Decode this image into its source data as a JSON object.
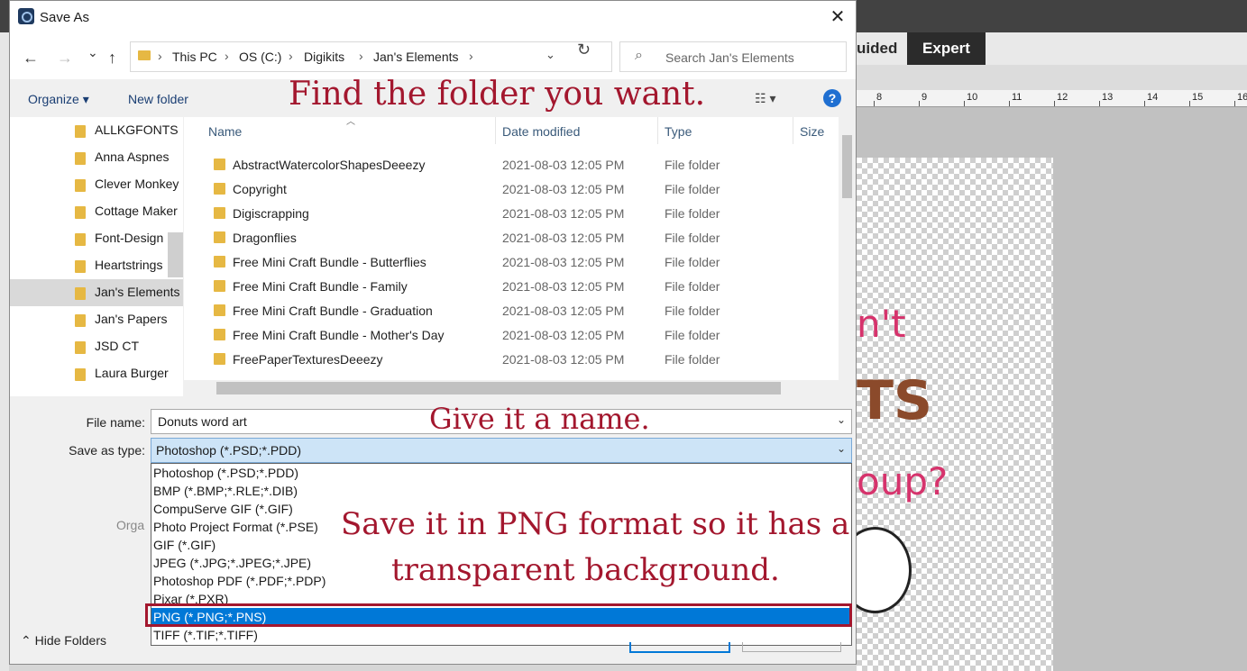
{
  "app": {
    "modes": {
      "guided": "uided",
      "expert": "Expert"
    },
    "ruler_numbers": [
      "8",
      "9",
      "10",
      "11",
      "12",
      "13",
      "14",
      "15",
      "16"
    ],
    "art_lines": [
      "n't",
      "TS",
      "oup?"
    ]
  },
  "dialog": {
    "title": "Save As",
    "close": "✕",
    "nav": {
      "back": "←",
      "forward": "→",
      "recent": "⌄",
      "up": "↑",
      "refresh": "↻"
    },
    "breadcrumb": [
      "This PC",
      "OS (C:)",
      "Digikits",
      "Jan's Elements"
    ],
    "crumb_sep": "›",
    "search_placeholder": "Search Jan's Elements",
    "toolbar": {
      "organize": "Organize ▾",
      "new_folder": "New folder",
      "view": "☷ ▾",
      "help": "?"
    },
    "nav_tree": [
      "ALLKGFONTS",
      "Anna Aspnes",
      "Clever Monkey",
      "Cottage Maker",
      "Font-Design",
      "Heartstrings",
      "Jan's Elements",
      "Jan's Papers",
      "JSD CT",
      "Laura Burger"
    ],
    "columns": {
      "name": "Name",
      "date": "Date modified",
      "type": "Type",
      "size": "Size"
    },
    "files": [
      {
        "name": "AbstractWatercolorShapesDeeezy",
        "date": "2021-08-03 12:05 PM",
        "type": "File folder"
      },
      {
        "name": "Copyright",
        "date": "2021-08-03 12:05 PM",
        "type": "File folder"
      },
      {
        "name": "Digiscrapping",
        "date": "2021-08-03 12:05 PM",
        "type": "File folder"
      },
      {
        "name": "Dragonflies",
        "date": "2021-08-03 12:05 PM",
        "type": "File folder"
      },
      {
        "name": "Free Mini Craft Bundle - Butterflies",
        "date": "2021-08-03 12:05 PM",
        "type": "File folder"
      },
      {
        "name": "Free Mini Craft Bundle - Family",
        "date": "2021-08-03 12:05 PM",
        "type": "File folder"
      },
      {
        "name": "Free Mini Craft Bundle - Graduation",
        "date": "2021-08-03 12:05 PM",
        "type": "File folder"
      },
      {
        "name": "Free Mini Craft Bundle - Mother's Day",
        "date": "2021-08-03 12:05 PM",
        "type": "File folder"
      },
      {
        "name": "FreePaperTexturesDeeezy",
        "date": "2021-08-03 12:05 PM",
        "type": "File folder"
      }
    ],
    "form": {
      "filename_label": "File name:",
      "filename_value": "Donuts word art",
      "saveas_label": "Save as type:",
      "saveas_value": "Photoshop (*.PSD;*.PDD)"
    },
    "type_options": [
      "Photoshop (*.PSD;*.PDD)",
      "BMP (*.BMP;*.RLE;*.DIB)",
      "CompuServe GIF (*.GIF)",
      "Photo Project Format (*.PSE)",
      "GIF (*.GIF)",
      "JPEG (*.JPG;*.JPEG;*.JPE)",
      "Photoshop PDF (*.PDF;*.PDP)",
      "Pixar (*.PXR)",
      "PNG (*.PNG;*.PNS)",
      "TIFF (*.TIF;*.TIFF)"
    ],
    "selected_type_index": 8,
    "hide_folders": "⌃  Hide Folders",
    "organize_ghost": "Orga"
  },
  "annotations": {
    "find_folder": "Find the folder you want.",
    "give_name": "Give it a name.",
    "png_line1": "Save it in PNG format so it has a",
    "png_line2": "transparent background."
  },
  "colors": {
    "annotation": "#a3172e",
    "selection": "#0078d7",
    "folder": "#e6b843"
  }
}
